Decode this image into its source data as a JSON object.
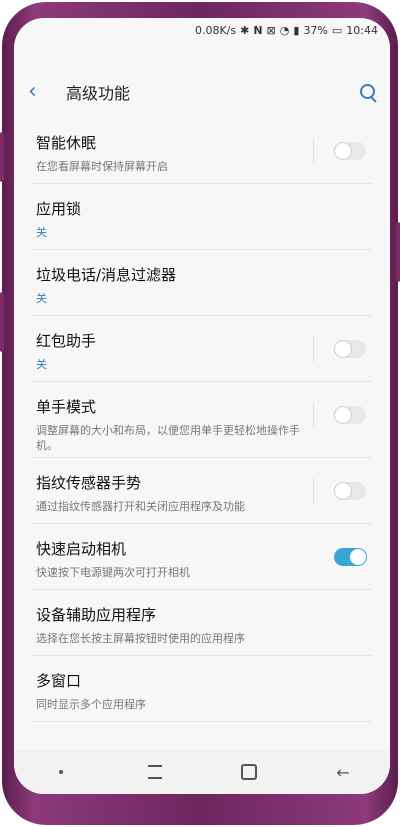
{
  "status": {
    "speed": "0.08K/s",
    "icons": [
      "bluetooth-icon",
      "nfc-icon",
      "mute-icon",
      "wifi-icon",
      "signal-icon"
    ],
    "battery": "37%",
    "time": "10:44"
  },
  "appbar": {
    "back_icon": "back-arrow-icon",
    "title": "高级功能",
    "search_icon": "search-icon"
  },
  "items": [
    {
      "title": "智能休眠",
      "subtitle": "在您看屏幕时保持屏幕开启",
      "subtitle_style": "gray",
      "has_toggle": true,
      "toggle_on": false
    },
    {
      "title": "应用锁",
      "subtitle": "关",
      "subtitle_style": "blue",
      "has_toggle": false,
      "toggle_on": false
    },
    {
      "title": "垃圾电话/消息过滤器",
      "subtitle": "关",
      "subtitle_style": "blue",
      "has_toggle": false,
      "toggle_on": false
    },
    {
      "title": "红包助手",
      "subtitle": "关",
      "subtitle_style": "blue",
      "has_toggle": true,
      "toggle_on": false
    },
    {
      "title": "单手模式",
      "subtitle": "调整屏幕的大小和布局，以便您用单手更轻松地操作手机。",
      "subtitle_style": "gray",
      "has_toggle": true,
      "toggle_on": false
    },
    {
      "title": "指纹传感器手势",
      "subtitle": "通过指纹传感器打开和关闭应用程序及功能",
      "subtitle_style": "gray",
      "has_toggle": true,
      "toggle_on": false
    },
    {
      "title": "快速启动相机",
      "subtitle": "快速按下电源键两次可打开相机",
      "subtitle_style": "gray",
      "has_toggle": false,
      "toggle_on": true,
      "toggle_only": true
    },
    {
      "title": "设备辅助应用程序",
      "subtitle": "选择在您长按主屏幕按钮时使用的应用程序",
      "subtitle_style": "gray",
      "has_toggle": false,
      "toggle_on": false
    },
    {
      "title": "多窗口",
      "subtitle": "同时显示多个应用程序",
      "subtitle_style": "gray",
      "has_toggle": false,
      "toggle_on": false
    }
  ],
  "navbar": {
    "dot_icon": "nav-dot-icon",
    "recent_icon": "recent-apps-icon",
    "home_icon": "home-icon",
    "back_icon": "nav-back-icon"
  },
  "colors": {
    "accent": "#3a7bbd",
    "toggle_on": "#3aa6d6",
    "phone_frame": "#6d2660"
  }
}
